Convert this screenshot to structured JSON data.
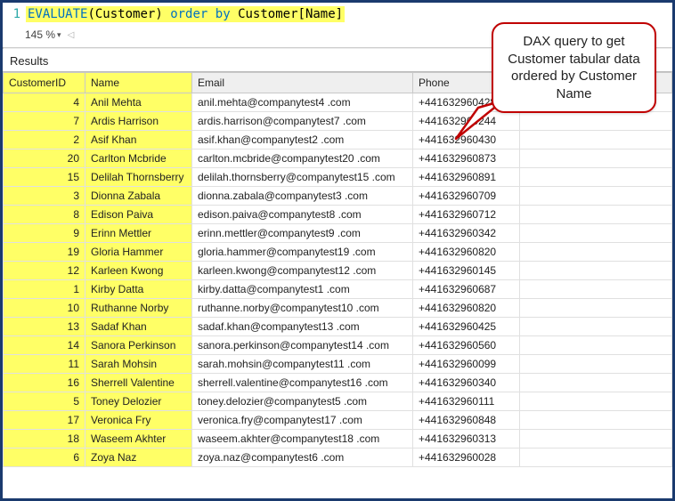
{
  "query": {
    "line_number": "1",
    "evaluate": "EVALUATE",
    "open_paren": "(",
    "table": "Customer",
    "close_paren": ")",
    "order_by": "order by",
    "ref_table": "Customer",
    "open_brack": "[",
    "ref_col": "Name",
    "close_brack": "]"
  },
  "zoom": {
    "value": "145 %"
  },
  "results_label": "Results",
  "callout_text": "DAX query to get Customer tabular data ordered by Customer Name",
  "columns": {
    "id": "CustomerID",
    "name": "Name",
    "email": "Email",
    "phone": "Phone"
  },
  "rows": [
    {
      "id": "4",
      "name": "Anil Mehta",
      "email": "anil.mehta@companytest4 .com",
      "phone": "+441632960428"
    },
    {
      "id": "7",
      "name": "Ardis Harrison",
      "email": "ardis.harrison@companytest7 .com",
      "phone": "+441632960244"
    },
    {
      "id": "2",
      "name": "Asif Khan",
      "email": "asif.khan@companytest2 .com",
      "phone": "+441632960430"
    },
    {
      "id": "20",
      "name": "Carlton Mcbride",
      "email": "carlton.mcbride@companytest20 .com",
      "phone": "+441632960873"
    },
    {
      "id": "15",
      "name": "Delilah Thornsberry",
      "email": "delilah.thornsberry@companytest15 .com",
      "phone": "+441632960891"
    },
    {
      "id": "3",
      "name": "Dionna Zabala",
      "email": "dionna.zabala@companytest3 .com",
      "phone": "+441632960709"
    },
    {
      "id": "8",
      "name": "Edison Paiva",
      "email": "edison.paiva@companytest8 .com",
      "phone": "+441632960712"
    },
    {
      "id": "9",
      "name": "Erinn Mettler",
      "email": "erinn.mettler@companytest9 .com",
      "phone": "+441632960342"
    },
    {
      "id": "19",
      "name": "Gloria Hammer",
      "email": "gloria.hammer@companytest19 .com",
      "phone": "+441632960820"
    },
    {
      "id": "12",
      "name": "Karleen Kwong",
      "email": "karleen.kwong@companytest12 .com",
      "phone": "+441632960145"
    },
    {
      "id": "1",
      "name": "Kirby Datta",
      "email": "kirby.datta@companytest1 .com",
      "phone": "+441632960687"
    },
    {
      "id": "10",
      "name": "Ruthanne Norby",
      "email": "ruthanne.norby@companytest10 .com",
      "phone": "+441632960820"
    },
    {
      "id": "13",
      "name": "Sadaf Khan",
      "email": "sadaf.khan@companytest13 .com",
      "phone": "+441632960425"
    },
    {
      "id": "14",
      "name": "Sanora Perkinson",
      "email": "sanora.perkinson@companytest14 .com",
      "phone": "+441632960560"
    },
    {
      "id": "11",
      "name": "Sarah Mohsin",
      "email": "sarah.mohsin@companytest11 .com",
      "phone": "+441632960099"
    },
    {
      "id": "16",
      "name": "Sherrell Valentine",
      "email": "sherrell.valentine@companytest16 .com",
      "phone": "+441632960340"
    },
    {
      "id": "5",
      "name": "Toney Delozier",
      "email": "toney.delozier@companytest5 .com",
      "phone": "+441632960111"
    },
    {
      "id": "17",
      "name": "Veronica Fry",
      "email": "veronica.fry@companytest17 .com",
      "phone": "+441632960848"
    },
    {
      "id": "18",
      "name": "Waseem Akhter",
      "email": "waseem.akhter@companytest18 .com",
      "phone": "+441632960313"
    },
    {
      "id": "6",
      "name": "Zoya Naz",
      "email": "zoya.naz@companytest6 .com",
      "phone": "+441632960028"
    }
  ]
}
